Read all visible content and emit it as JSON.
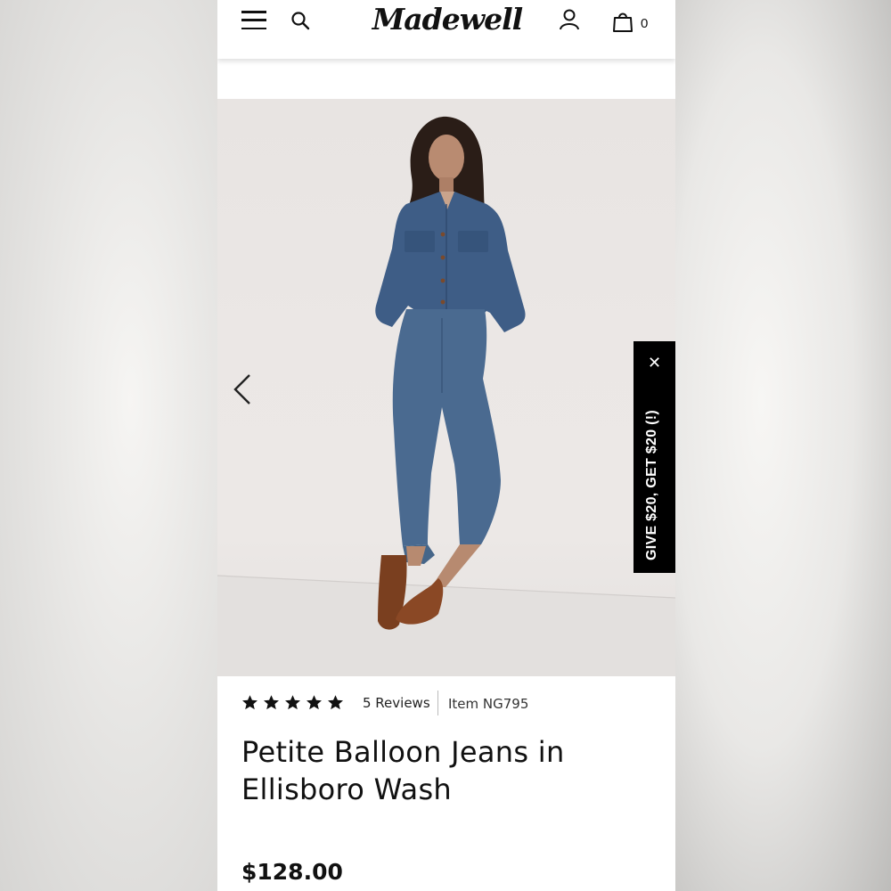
{
  "brand": {
    "logo_text": "Madewell"
  },
  "header": {
    "cart_count": "0"
  },
  "promo": {
    "label": "GIVE $20, GET $20 (!)",
    "close_glyph": "✕"
  },
  "product": {
    "rating": 5,
    "rating_max": 5,
    "reviews_label": "5 Reviews",
    "item_number": "Item NG795",
    "title": "Petite Balloon Jeans in Ellisboro Wash",
    "price": "$128.00"
  },
  "icons": [
    "menu-icon",
    "search-icon",
    "account-icon",
    "bag-icon",
    "chevron-left-icon",
    "close-icon",
    "star-icon"
  ]
}
